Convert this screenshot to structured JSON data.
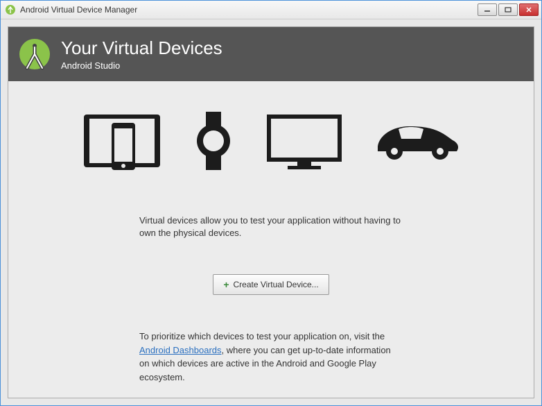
{
  "window": {
    "title": "Android Virtual Device Manager"
  },
  "header": {
    "title": "Your Virtual Devices",
    "subtitle": "Android Studio"
  },
  "body": {
    "description": "Virtual devices allow you to test your application without having to own the physical devices.",
    "create_label": "Create Virtual Device...",
    "footer_pre": "To prioritize which devices to test your application on, visit the ",
    "footer_link": "Android Dashboards",
    "footer_post": ", where you can get up-to-date information on which devices are active in the Android and Google Play ecosystem."
  },
  "icons": {
    "devices": [
      "tablet-phone",
      "watch",
      "tv",
      "car"
    ]
  },
  "colors": {
    "accent_green": "#8bc34a"
  }
}
